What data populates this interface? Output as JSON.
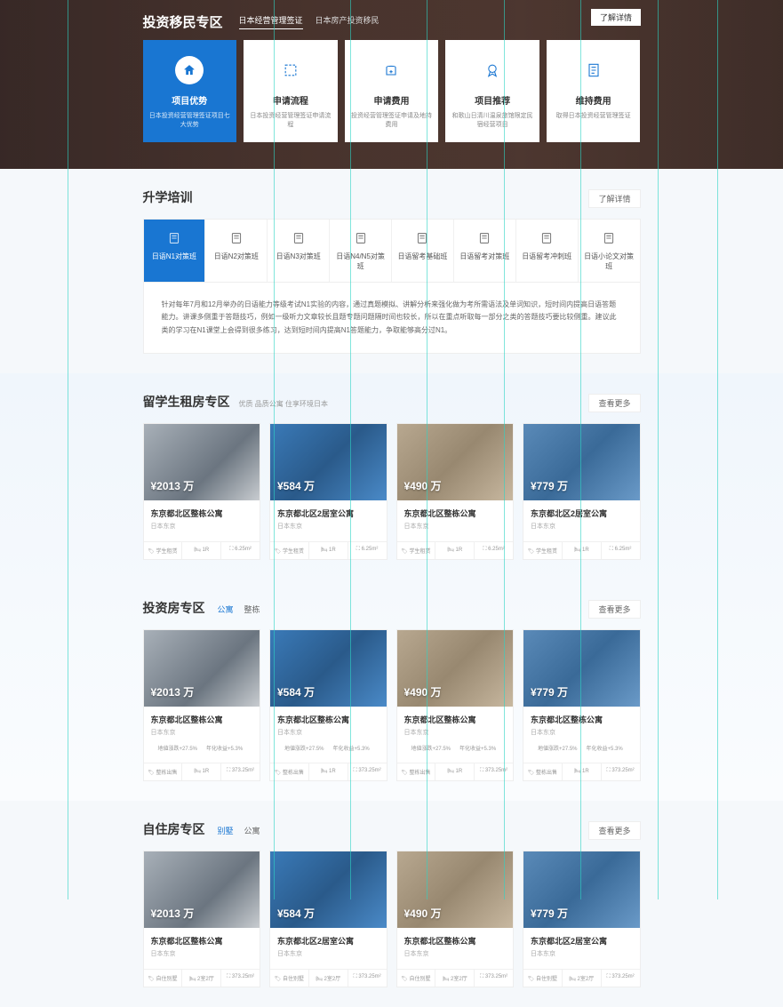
{
  "hero": {
    "title": "投资移民专区",
    "tabs": [
      "日本经营管理签证",
      "日本房产投资移民"
    ],
    "more": "了解详情",
    "cards": [
      {
        "title": "项目优势",
        "desc": "日本投资经营管理签证项目七大优势"
      },
      {
        "title": "申请流程",
        "desc": "日本投资经营管理签证申请流程"
      },
      {
        "title": "申请费用",
        "desc": "投资经营管理签证申请及地持费用"
      },
      {
        "title": "项目推荐",
        "desc": "和歌山日清川温泉旅馆限定民宿经营项目"
      },
      {
        "title": "维持费用",
        "desc": "取得日本投资经营管理签证"
      }
    ]
  },
  "study": {
    "title": "升学培训",
    "more": "了解详情",
    "tabs": [
      "日语N1对策班",
      "日语N2对策班",
      "日语N3对策班",
      "日语N4/N5对策班",
      "日语留考基础班",
      "日语留考对策班",
      "日语留考冲刺班",
      "日语小论文对策班"
    ],
    "content": "针对每年7月和12月举办的日语能力等级考试N1实验的内容，通过真题模拟、讲解分析来强化做为考所需语法及单词知识，短时间内提高日语答题能力。讲课多侧重于答题技巧，例如一级听力文章较长且题专题问题隔时间也较长，所以在重点听取每一部分之类的答题技巧要比较侧重。建议此类的学习在N1课堂上会得到很多练习，达到短时间内提高N1答题能力，争取能够高分过N1。"
  },
  "rental": {
    "title": "留学生租房专区",
    "subtitle": "优质 品质公寓 住享环境日本",
    "more": "查看更多",
    "cards": [
      {
        "price": "¥2013 万",
        "name": "东京都北区整栋公寓",
        "loc": "日本东京",
        "tag": "学生租赁",
        "rooms": "1R",
        "area": "6.25m²"
      },
      {
        "price": "¥584 万",
        "name": "东京都北区2居室公寓",
        "loc": "日本东京",
        "tag": "学生租赁",
        "rooms": "1R",
        "area": "6.25m²"
      },
      {
        "price": "¥490 万",
        "name": "东京都北区整栋公寓",
        "loc": "日本东京",
        "tag": "学生租赁",
        "rooms": "1R",
        "area": "6.25m²"
      },
      {
        "price": "¥779 万",
        "name": "东京都北区2居室公寓",
        "loc": "日本东京",
        "tag": "学生租赁",
        "rooms": "1R",
        "area": "6.25m²"
      }
    ]
  },
  "invest": {
    "title": "投资房专区",
    "filters": [
      "公寓",
      "整栋"
    ],
    "more": "查看更多",
    "cards": [
      {
        "price": "¥2013 万",
        "name": "东京都北区整栋公寓",
        "loc": "日本东京",
        "s1": "地値涨跌+27.5%",
        "s2": "年化收益+5.3%",
        "tag": "整栋出售",
        "rooms": "1R",
        "area": "373.25m²"
      },
      {
        "price": "¥584 万",
        "name": "东京都北区整栋公寓",
        "loc": "日本东京",
        "s1": "地値涨跌+27.5%",
        "s2": "年化收益+5.3%",
        "tag": "整栋出售",
        "rooms": "1R",
        "area": "373.25m²"
      },
      {
        "price": "¥490 万",
        "name": "东京都北区整栋公寓",
        "loc": "日本东京",
        "s1": "地値涨跌+27.5%",
        "s2": "年化收益+5.3%",
        "tag": "整栋出售",
        "rooms": "1R",
        "area": "373.25m²"
      },
      {
        "price": "¥779 万",
        "name": "东京都北区整栋公寓",
        "loc": "日本东京",
        "s1": "地値涨跌+27.5%",
        "s2": "年化收益+5.3%",
        "tag": "整栋出售",
        "rooms": "1R",
        "area": "373.25m²"
      }
    ]
  },
  "self": {
    "title": "自住房专区",
    "filters": [
      "别墅",
      "公寓"
    ],
    "more": "查看更多",
    "cards": [
      {
        "price": "¥2013 万",
        "name": "东京都北区整栋公寓",
        "loc": "日本东京",
        "tag": "自住别墅",
        "rooms": "2室2厅",
        "area": "373.25m²"
      },
      {
        "price": "¥584 万",
        "name": "东京都北区2居室公寓",
        "loc": "日本东京",
        "tag": "自住别墅",
        "rooms": "2室2厅",
        "area": "373.25m²"
      },
      {
        "price": "¥490 万",
        "name": "东京都北区整栋公寓",
        "loc": "日本东京",
        "tag": "自住别墅",
        "rooms": "2室2厅",
        "area": "373.25m²"
      },
      {
        "price": "¥779 万",
        "name": "东京都北区2居室公寓",
        "loc": "日本东京",
        "tag": "自住别墅",
        "rooms": "2室2厅",
        "area": "373.25m²"
      }
    ]
  }
}
